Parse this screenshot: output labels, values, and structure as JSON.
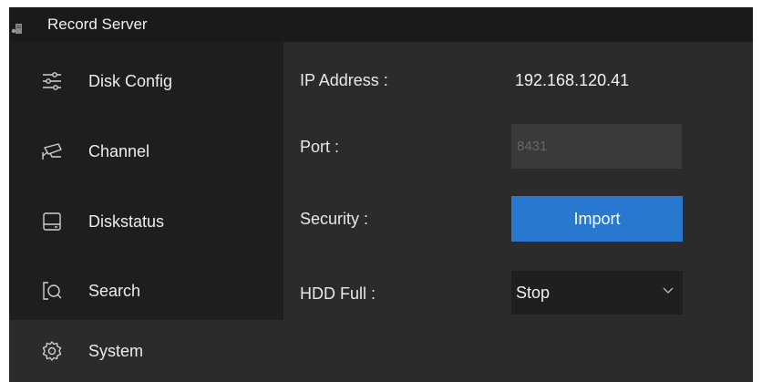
{
  "window": {
    "title": "Record Server",
    "app_icon": "server-app-icon"
  },
  "sidebar": {
    "items": [
      {
        "label": "Disk Config",
        "icon": "sliders-icon",
        "selected": false
      },
      {
        "label": "Channel",
        "icon": "camera-icon",
        "selected": false
      },
      {
        "label": "Diskstatus",
        "icon": "drive-icon",
        "selected": false
      },
      {
        "label": "Search",
        "icon": "search-icon",
        "selected": false
      },
      {
        "label": "System",
        "icon": "gear-icon",
        "selected": true
      }
    ]
  },
  "form": {
    "ip_label": "IP Address :",
    "ip_value": "192.168.120.41",
    "port_label": "Port :",
    "port_placeholder": "8431",
    "security_label": "Security :",
    "import_label": "Import",
    "hdd_label": "HDD Full :",
    "hdd_value": "Stop"
  },
  "colors": {
    "background": "#1a1a1a",
    "panel": "#2b2b2b",
    "accent": "#2878d0",
    "text": "#e6e6e6"
  }
}
